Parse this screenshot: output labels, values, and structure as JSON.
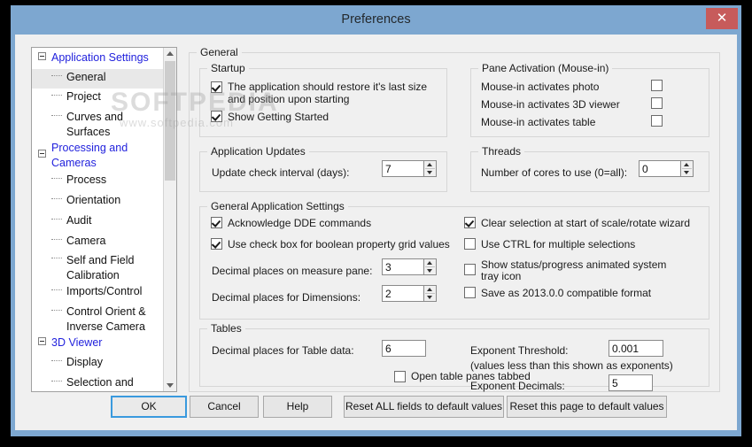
{
  "window": {
    "title": "Preferences",
    "close_label": "✕",
    "accent_titlebar": "#7da7d0",
    "accent_close": "#c75b5b",
    "accent_default_button": "#3a9ade"
  },
  "watermark": {
    "line1": "SOFTPEDIA",
    "line2": "www.softpedia.com"
  },
  "tree": {
    "nodes": [
      {
        "label": "Application Settings",
        "type": "group",
        "expander": "minus-icon",
        "selected": false
      },
      {
        "label": "General",
        "type": "child",
        "selected": true
      },
      {
        "label": "Project",
        "type": "child",
        "selected": false
      },
      {
        "label": "Curves and Surfaces",
        "type": "child",
        "selected": false
      },
      {
        "label": "Processing and Cameras",
        "type": "group",
        "expander": "minus-icon",
        "selected": false
      },
      {
        "label": "Process",
        "type": "child",
        "selected": false
      },
      {
        "label": "Orientation",
        "type": "child",
        "selected": false
      },
      {
        "label": "Audit",
        "type": "child",
        "selected": false
      },
      {
        "label": "Camera",
        "type": "child",
        "selected": false
      },
      {
        "label": "Self and Field Calibration",
        "type": "child",
        "selected": false
      },
      {
        "label": "Imports/Control",
        "type": "child",
        "selected": false
      },
      {
        "label": "Control Orient & Inverse Camera",
        "type": "child",
        "selected": false
      },
      {
        "label": "3D Viewer",
        "type": "group",
        "expander": "minus-icon",
        "selected": false
      },
      {
        "label": "Display",
        "type": "child",
        "selected": false
      },
      {
        "label": "Selection and Navigation",
        "type": "child",
        "selected": false
      }
    ]
  },
  "page": {
    "legend": "General",
    "startup": {
      "legend": "Startup",
      "restore_label": "The application should restore it's last size and position upon starting",
      "restore_checked": true,
      "getting_started_label": "Show Getting Started",
      "getting_started_checked": true
    },
    "pane_activation": {
      "legend": "Pane Activation (Mouse-in)",
      "photo_label": "Mouse-in activates photo",
      "photo_checked": false,
      "viewer_label": "Mouse-in activates 3D viewer",
      "viewer_checked": false,
      "table_label": "Mouse-in activates table",
      "table_checked": false
    },
    "application_updates": {
      "legend": "Application Updates",
      "interval_label": "Update check interval (days):",
      "interval_value": "7"
    },
    "threads": {
      "legend": "Threads",
      "cores_label": "Number of cores to use (0=all):",
      "cores_value": "0"
    },
    "general_settings": {
      "legend": "General Application Settings",
      "dde_label": "Acknowledge DDE commands",
      "dde_checked": true,
      "boolean_grid_label": "Use check box for boolean property grid values",
      "boolean_grid_checked": true,
      "measure_decimals_label": "Decimal places on measure pane:",
      "measure_decimals_value": "3",
      "dimension_decimals_label": "Decimal places for Dimensions:",
      "dimension_decimals_value": "2",
      "clear_selection_label": "Clear selection at start of scale/rotate wizard",
      "clear_selection_checked": true,
      "ctrl_multi_label": "Use CTRL for multiple selections",
      "ctrl_multi_checked": false,
      "tray_icon_label": "Show status/progress animated system tray icon",
      "tray_icon_checked": false,
      "compat_label": "Save as 2013.0.0 compatible format",
      "compat_checked": false
    },
    "tables": {
      "legend": "Tables",
      "table_decimals_label": "Decimal places for Table data:",
      "table_decimals_value": "6",
      "tabbed_label": "Open table panes tabbed",
      "tabbed_checked": false,
      "exponent_threshold_label": "Exponent Threshold:",
      "exponent_threshold_value": "0.001",
      "exponent_note": "(values less than this shown as exponents)",
      "exponent_decimals_label": "Exponent Decimals:",
      "exponent_decimals_value": "5"
    }
  },
  "buttons": {
    "ok": "OK",
    "cancel": "Cancel",
    "help": "Help",
    "reset_all": "Reset ALL fields to default values",
    "reset_page": "Reset this page to default values"
  }
}
